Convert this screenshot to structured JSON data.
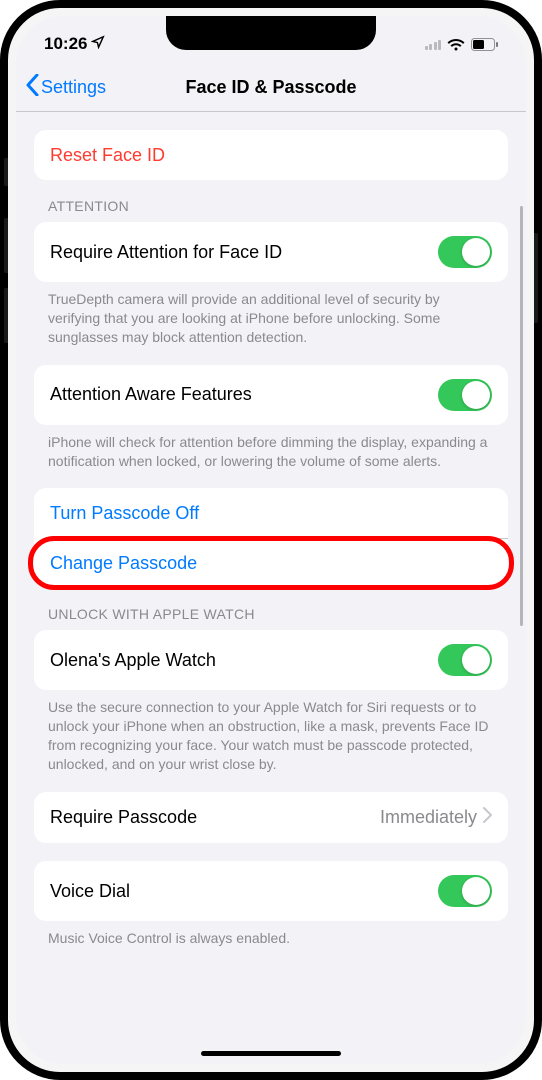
{
  "status": {
    "time": "10:26",
    "location_icon": "location-arrow"
  },
  "nav": {
    "back_label": "Settings",
    "title": "Face ID & Passcode"
  },
  "reset": {
    "label": "Reset Face ID"
  },
  "attention": {
    "header": "ATTENTION",
    "require_label": "Require Attention for Face ID",
    "require_on": true,
    "require_footer": "TrueDepth camera will provide an additional level of security by verifying that you are looking at iPhone before unlocking. Some sunglasses may block attention detection.",
    "aware_label": "Attention Aware Features",
    "aware_on": true,
    "aware_footer": "iPhone will check for attention before dimming the display, expanding a notification when locked, or lowering the volume of some alerts."
  },
  "passcode": {
    "turn_off_label": "Turn Passcode Off",
    "change_label": "Change Passcode"
  },
  "watch": {
    "header": "UNLOCK WITH APPLE WATCH",
    "device_label": "Olena's Apple Watch",
    "device_on": true,
    "footer": "Use the secure connection to your Apple Watch for Siri requests or to unlock your iPhone when an obstruction, like a mask, prevents Face ID from recognizing your face. Your watch must be passcode protected, unlocked, and on your wrist close by."
  },
  "require_passcode": {
    "label": "Require Passcode",
    "value": "Immediately"
  },
  "voice_dial": {
    "label": "Voice Dial",
    "on": true,
    "footer": "Music Voice Control is always enabled."
  }
}
